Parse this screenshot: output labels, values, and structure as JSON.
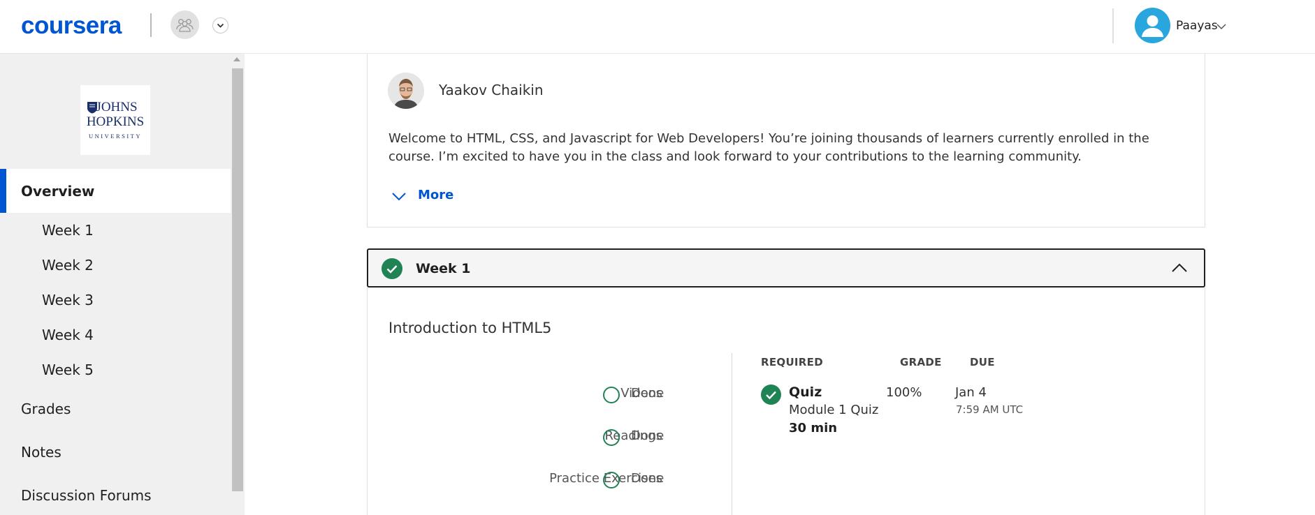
{
  "header": {
    "logo_text": "coursera",
    "user_name": "Paayas"
  },
  "sidebar": {
    "university_line1": "JOHNS",
    "university_line2": "HOPKINS",
    "university_line3": "UNIVERSITY",
    "items": [
      {
        "label": "Overview",
        "active": true
      },
      {
        "label": "Week 1"
      },
      {
        "label": "Week 2"
      },
      {
        "label": "Week 3"
      },
      {
        "label": "Week 4"
      },
      {
        "label": "Week 5"
      },
      {
        "label": "Grades"
      },
      {
        "label": "Notes"
      },
      {
        "label": "Discussion Forums"
      }
    ]
  },
  "instructor": {
    "name": "Yaakov Chaikin",
    "welcome": "Welcome to HTML, CSS, and Javascript for Web Developers! You’re joining thousands of learners currently enrolled in the course. I’m excited to have you in the class and look forward to your contributions to the learning community.",
    "more_label": "More"
  },
  "week": {
    "title": "Week 1",
    "completed": true,
    "module_title": "Introduction to HTML5",
    "stats": [
      {
        "label": "Videos",
        "status": "Done"
      },
      {
        "label": "Readings",
        "status": "Done"
      },
      {
        "label": "Practice Exercises",
        "status": "Done"
      }
    ],
    "table": {
      "headers": {
        "required": "REQUIRED",
        "grade": "GRADE",
        "due": "DUE"
      },
      "rows": [
        {
          "type": "Quiz",
          "name": "Module 1 Quiz",
          "duration": "30 min",
          "grade": "100%",
          "due_date": "Jan 4",
          "due_time": "7:59 AM UTC"
        }
      ]
    }
  },
  "colors": {
    "brand": "#0056d2",
    "success": "#1f8354",
    "avatar": "#2aa6de"
  }
}
